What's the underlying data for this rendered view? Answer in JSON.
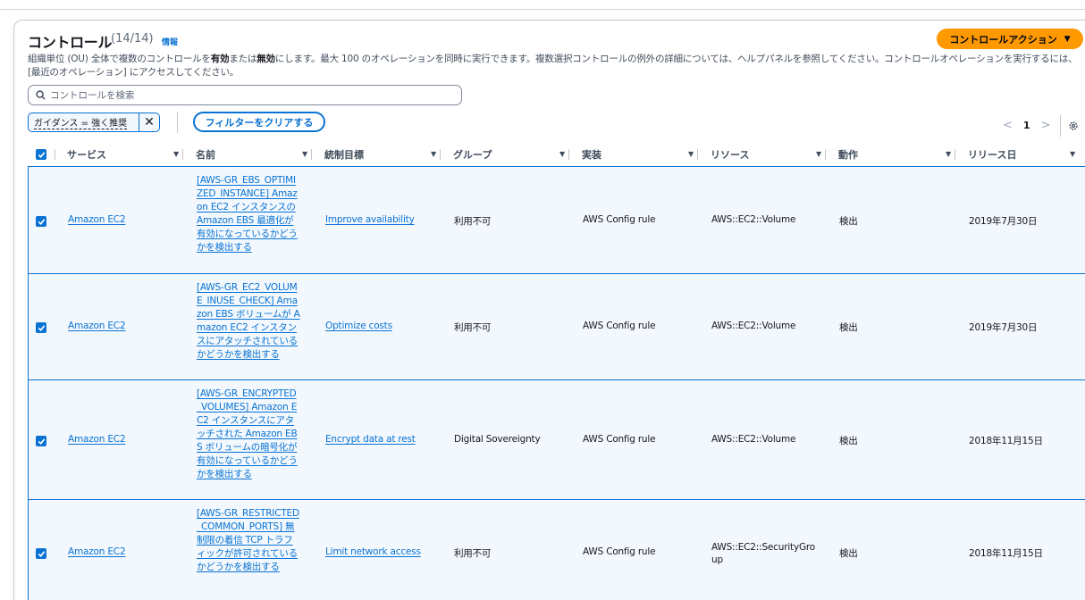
{
  "panel": {
    "title": "コントロール",
    "count": "(14/14)",
    "info": "情報",
    "action_label": "コントロールアクション",
    "description_pre": "組織単位 (OU) 全体で複数のコントロールを",
    "description_b1": "有効",
    "description_mid": "または",
    "description_b2": "無効",
    "description_post": "にします。最大 100 のオペレーションを同時に実行できます。複数選択コントロールの例外の詳細については、ヘルプパネルを参照してください。コントロールオペレーションを実行するには、[最近のオペレーション] にアクセスしてください。"
  },
  "search": {
    "placeholder": "コントロールを検索"
  },
  "filter": {
    "token_label": "ガイダンス = 強く推奨",
    "clear_label": "フィルターをクリアする"
  },
  "pagination": {
    "page": "1"
  },
  "columns": [
    "サービス",
    "名前",
    "統制目標",
    "グループ",
    "実装",
    "リソース",
    "動作",
    "リリース日"
  ],
  "rows": [
    {
      "service": "Amazon EC2",
      "name": "[AWS-GR_EBS_OPTIMIZED_INSTANCE] Amazon EC2 インスタンスの Amazon EBS 最適化が有効になっているかどうかを検出する",
      "objective": "Improve availability",
      "group": "利用不可",
      "implementation": "AWS Config rule",
      "resource": "AWS::EC2::Volume",
      "behavior": "検出",
      "release_date": "2019年7月30日"
    },
    {
      "service": "Amazon EC2",
      "name": "[AWS-GR_EC2_VOLUME_INUSE_CHECK] Amazon EBS ボリュームが Amazon EC2 インスタンスにアタッチされているかどうかを検出する",
      "objective": "Optimize costs",
      "group": "利用不可",
      "implementation": "AWS Config rule",
      "resource": "AWS::EC2::Volume",
      "behavior": "検出",
      "release_date": "2019年7月30日"
    },
    {
      "service": "Amazon EC2",
      "name": "[AWS-GR_ENCRYPTED_VOLUMES] Amazon EC2 インスタンスにアタッチされた Amazon EBS ボリュームの暗号化が有効になっているかどうかを検出する",
      "objective": "Encrypt data at rest",
      "group": "Digital Sovereignty",
      "implementation": "AWS Config rule",
      "resource": "AWS::EC2::Volume",
      "behavior": "検出",
      "release_date": "2018年11月15日"
    },
    {
      "service": "Amazon EC2",
      "name": "[AWS-GR_RESTRICTED_COMMON_PORTS] 無制限の着信 TCP トラフィックが許可されているかどうかを検出する",
      "objective": "Limit network access",
      "group": "利用不可",
      "implementation": "AWS Config rule",
      "resource": "AWS::EC2::SecurityGroup",
      "behavior": "検出",
      "release_date": "2018年11月15日"
    }
  ]
}
